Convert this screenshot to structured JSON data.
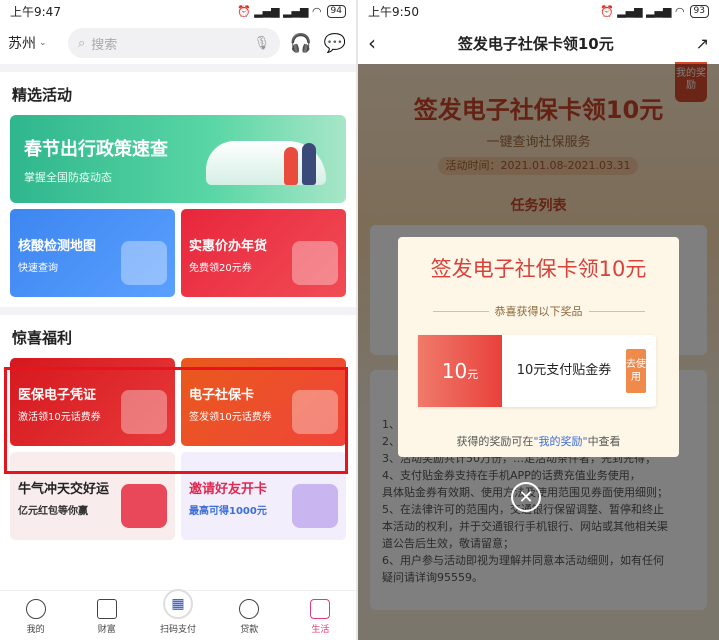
{
  "left": {
    "status": {
      "time": "上午9:47",
      "signal": "..|| ⏰ .ıl .ıl ≋",
      "battery": "94"
    },
    "header": {
      "city": "苏州",
      "search_placeholder": "搜索"
    },
    "featured": {
      "title": "精选活动",
      "banner": {
        "title": "春节出行政策速查",
        "subtitle": "掌握全国防疫动态"
      },
      "cards": [
        {
          "title": "核酸检测地图",
          "subtitle": "快速查询",
          "color": "#3a7fe8"
        },
        {
          "title": "实惠价办年货",
          "subtitle": "免费领20元券",
          "color": "#e8263c"
        }
      ]
    },
    "welfare": {
      "title": "惊喜福利",
      "cards": [
        {
          "title": "医保电子凭证",
          "subtitle": "激活领10元话费券",
          "color": "#d91f2a"
        },
        {
          "title": "电子社保卡",
          "subtitle": "签发领10元话费券",
          "color": "#e8561d"
        },
        {
          "title": "牛气冲天交好运",
          "subtitle": "亿元红包等你赢",
          "color": "#f9ecec"
        },
        {
          "title": "邀请好友开卡",
          "subtitle": "最高可得1000元",
          "color": "#f2eefc"
        }
      ]
    },
    "tabs": [
      "我的",
      "财富",
      "扫码支付",
      "贷款",
      "生活"
    ]
  },
  "right": {
    "status": {
      "time": "上午9:50",
      "battery": "93"
    },
    "header": {
      "title": "签发电子社保卡领10元"
    },
    "bg": {
      "title": "签发电子社保卡领10元",
      "subtitle": "一键查询社保服务",
      "date": "活动时间：2021.01.08-2021.03.31",
      "task_title": "任务列表",
      "my_prize": "我的奖励"
    },
    "rules": [
      "1、…",
      "2、…",
      "3、活动奖励共计50万份，…足活动条件者，先到先得；",
      "4、支付贴金券支持在手机APP的话费充值业务使用，",
      "具体贴金券有效期、使用方法及使用范围见券面使用细则；",
      "5、在法律许可的范围内，交通银行保留调整、暂停和终止",
      "本活动的权利，并于交通银行手机银行、网站或其他相关渠",
      "道公告后生效，敬请留意；",
      "6、用户参与活动即视为理解并同意本活动细则，如有任何",
      "疑问请详询95559。"
    ],
    "modal": {
      "title": "签发电子社保卡领10元",
      "subtitle": "恭喜获得以下奖品",
      "coupon_amount": "10",
      "coupon_unit": "元",
      "coupon_desc": "10元支付贴金券",
      "use_label": "去使用",
      "footer_pre": "获得的奖励可在",
      "footer_link": "\"我的奖励\"",
      "footer_post": "中查看"
    }
  }
}
